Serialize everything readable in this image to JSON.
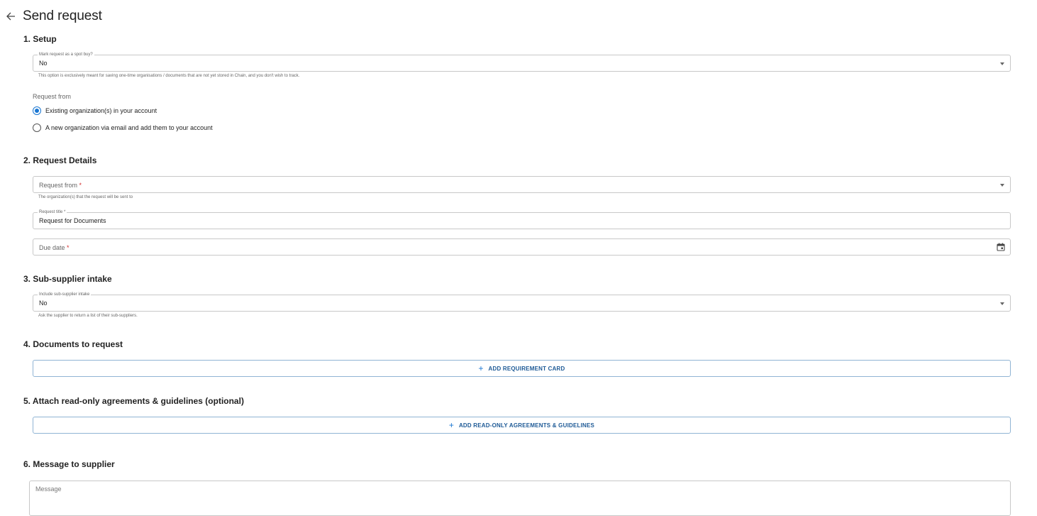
{
  "page": {
    "title": "Send request"
  },
  "sections": {
    "setup": "1. Setup",
    "details": "2. Request Details",
    "subsupplier": "3. Sub-supplier intake",
    "documents": "4. Documents to request",
    "agreements": "5. Attach read-only agreements & guidelines (optional)",
    "message": "6. Message to supplier"
  },
  "setup": {
    "spot_buy": {
      "label": "Mark request as a spot buy?",
      "value": "No",
      "helper": "This option is exclusively meant for saving one-time organisations / documents that are not yet stored in Chain, and you don't wish to track."
    },
    "request_from_label": "Request from",
    "options": [
      {
        "label": "Existing organization(s) in your account",
        "selected": true
      },
      {
        "label": "A new organization via email and add them to your account",
        "selected": false
      }
    ]
  },
  "details": {
    "request_from": {
      "placeholder": "Request from",
      "required": "*",
      "helper": "The organization(s) that the request will be sent to"
    },
    "title": {
      "label": "Request title *",
      "value": "Request for Documents"
    },
    "due_date": {
      "placeholder": "Due date",
      "required": "*"
    }
  },
  "subsupplier": {
    "label": "Include sub-supplier intake",
    "value": "No",
    "helper": "Ask the supplier to return a list of their sub-suppliers."
  },
  "documents": {
    "button_label": "ADD REQUIREMENT CARD"
  },
  "agreements": {
    "button_label": "ADD READ-ONLY AGREEMENTS & GUIDELINES"
  },
  "message": {
    "placeholder": "Message"
  },
  "colors": {
    "accent": "#1976d2",
    "required": "#d32f2f",
    "border": "#c8c8c8",
    "button_border": "#90b4d4"
  }
}
